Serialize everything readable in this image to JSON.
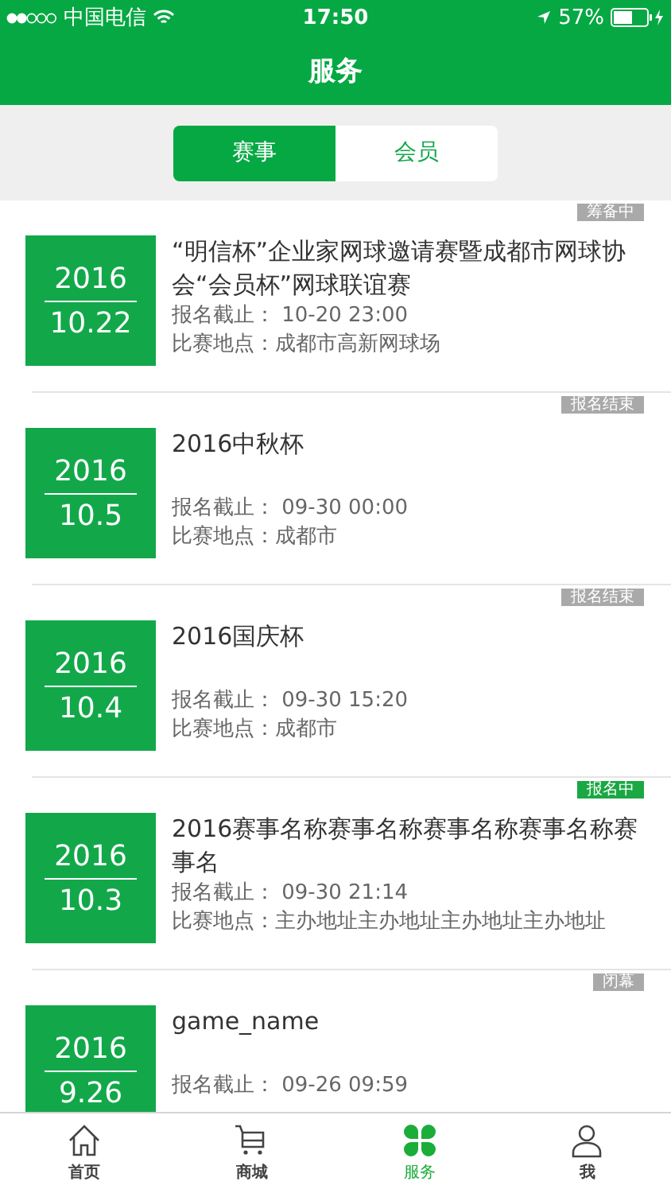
{
  "status_bar": {
    "carrier": "中国电信",
    "time": "17:50",
    "battery": "57%"
  },
  "nav": {
    "title": "服务"
  },
  "segments": [
    {
      "label": "赛事",
      "selected": true
    },
    {
      "label": "会员",
      "selected": false
    }
  ],
  "events": [
    {
      "year": "2016",
      "day": "10.22",
      "title": "“明信杯”企业家网球邀请赛暨成都市网球协会“会员杯”网球联谊赛",
      "deadline": "报名截止： 10-20 23:00",
      "location": "比赛地点：成都市高新网球场",
      "badge": {
        "text": "筹备中",
        "color": "#a9a9a9"
      }
    },
    {
      "year": "2016",
      "day": "10.5",
      "title": "2016中秋杯",
      "deadline": "报名截止： 09-30 00:00",
      "location": "比赛地点：成都市",
      "badge": {
        "text": "报名结束",
        "color": "#a9a9a9"
      }
    },
    {
      "year": "2016",
      "day": "10.4",
      "title": "2016国庆杯",
      "deadline": "报名截止： 09-30 15:20",
      "location": "比赛地点：成都市",
      "badge": {
        "text": "报名结束",
        "color": "#a9a9a9"
      }
    },
    {
      "year": "2016",
      "day": "10.3",
      "title": "2016赛事名称赛事名称赛事名称赛事名称赛事名",
      "deadline": "报名截止： 09-30 21:14",
      "location": "比赛地点：主办地址主办地址主办地址主办地址",
      "badge": {
        "text": "报名中",
        "color": "#1aa843"
      }
    },
    {
      "year": "2016",
      "day": "9.26",
      "title": "game_name",
      "deadline": "报名截止： 09-26 09:59",
      "badge": {
        "text": "闭幕",
        "color": "#a9a9a9"
      }
    }
  ],
  "tabbar": [
    {
      "label": "首页",
      "kind": "home",
      "selected": false
    },
    {
      "label": "商城",
      "kind": "cart",
      "selected": false
    },
    {
      "label": "服务",
      "kind": "clover",
      "selected": true
    },
    {
      "label": "我",
      "kind": "person",
      "selected": false
    }
  ]
}
